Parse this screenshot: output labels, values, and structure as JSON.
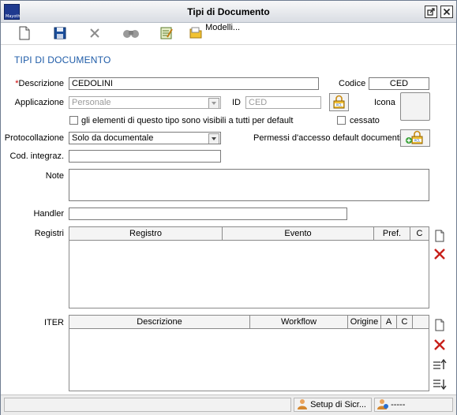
{
  "window": {
    "title": "Tipi di Documento",
    "app_icon_text": "Mayoth"
  },
  "toolbar": {
    "modelli_label": "Modelli..."
  },
  "section_title": "TIPI DI DOCUMENTO",
  "form": {
    "descrizione": {
      "label": "Descrizione",
      "required_mark": "*",
      "value": "CEDOLINI"
    },
    "codice": {
      "label": "Codice",
      "value": "CED"
    },
    "applicazione": {
      "label": "Applicazione",
      "value": "Personale"
    },
    "id": {
      "label": "ID",
      "value": "CED"
    },
    "icona": {
      "label": "Icona"
    },
    "visibile_tutti": {
      "label": "gli elementi di questo tipo sono visibili a tutti per default",
      "checked": false
    },
    "cessato": {
      "label": "cessato",
      "checked": false
    },
    "protocollazione": {
      "label": "Protocollazione",
      "value": "Solo da documentale"
    },
    "permessi": {
      "label": "Permessi d'accesso default documenti"
    },
    "cod_integraz": {
      "label": "Cod. integraz.",
      "value": ""
    },
    "note": {
      "label": "Note",
      "value": ""
    },
    "handler": {
      "label": "Handler",
      "value": ""
    }
  },
  "registri": {
    "label": "Registri",
    "columns": [
      "Registro",
      "Evento",
      "Pref.",
      "C"
    ],
    "rows": []
  },
  "iter": {
    "label": "ITER",
    "columns": [
      "Descrizione",
      "Workflow",
      "Origine",
      "A",
      "C"
    ],
    "rows": []
  },
  "statusbar": {
    "setup_label": "Setup di Sicr...",
    "user_label": "-----"
  },
  "colors": {
    "accent": "#1f5ca8",
    "delete": "#c8201a",
    "required": "#cc0000"
  }
}
